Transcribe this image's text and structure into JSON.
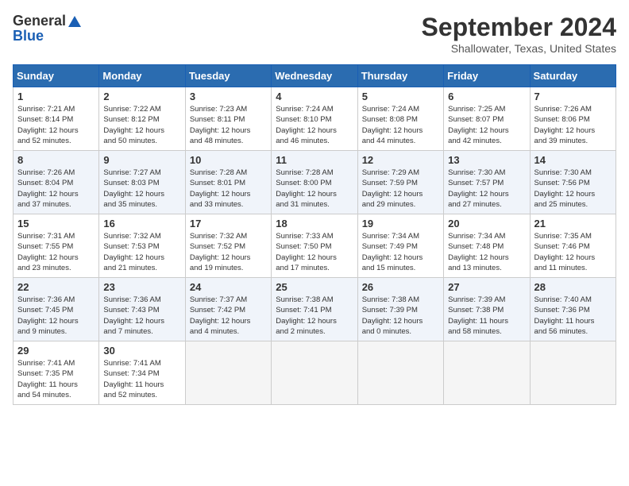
{
  "header": {
    "logo_line1": "General",
    "logo_line2": "Blue",
    "title": "September 2024",
    "location": "Shallowater, Texas, United States"
  },
  "days_of_week": [
    "Sunday",
    "Monday",
    "Tuesday",
    "Wednesday",
    "Thursday",
    "Friday",
    "Saturday"
  ],
  "weeks": [
    [
      {
        "day": "1",
        "lines": [
          "Sunrise: 7:21 AM",
          "Sunset: 8:14 PM",
          "Daylight: 12 hours",
          "and 52 minutes."
        ]
      },
      {
        "day": "2",
        "lines": [
          "Sunrise: 7:22 AM",
          "Sunset: 8:12 PM",
          "Daylight: 12 hours",
          "and 50 minutes."
        ]
      },
      {
        "day": "3",
        "lines": [
          "Sunrise: 7:23 AM",
          "Sunset: 8:11 PM",
          "Daylight: 12 hours",
          "and 48 minutes."
        ]
      },
      {
        "day": "4",
        "lines": [
          "Sunrise: 7:24 AM",
          "Sunset: 8:10 PM",
          "Daylight: 12 hours",
          "and 46 minutes."
        ]
      },
      {
        "day": "5",
        "lines": [
          "Sunrise: 7:24 AM",
          "Sunset: 8:08 PM",
          "Daylight: 12 hours",
          "and 44 minutes."
        ]
      },
      {
        "day": "6",
        "lines": [
          "Sunrise: 7:25 AM",
          "Sunset: 8:07 PM",
          "Daylight: 12 hours",
          "and 42 minutes."
        ]
      },
      {
        "day": "7",
        "lines": [
          "Sunrise: 7:26 AM",
          "Sunset: 8:06 PM",
          "Daylight: 12 hours",
          "and 39 minutes."
        ]
      }
    ],
    [
      {
        "day": "8",
        "lines": [
          "Sunrise: 7:26 AM",
          "Sunset: 8:04 PM",
          "Daylight: 12 hours",
          "and 37 minutes."
        ]
      },
      {
        "day": "9",
        "lines": [
          "Sunrise: 7:27 AM",
          "Sunset: 8:03 PM",
          "Daylight: 12 hours",
          "and 35 minutes."
        ]
      },
      {
        "day": "10",
        "lines": [
          "Sunrise: 7:28 AM",
          "Sunset: 8:01 PM",
          "Daylight: 12 hours",
          "and 33 minutes."
        ]
      },
      {
        "day": "11",
        "lines": [
          "Sunrise: 7:28 AM",
          "Sunset: 8:00 PM",
          "Daylight: 12 hours",
          "and 31 minutes."
        ]
      },
      {
        "day": "12",
        "lines": [
          "Sunrise: 7:29 AM",
          "Sunset: 7:59 PM",
          "Daylight: 12 hours",
          "and 29 minutes."
        ]
      },
      {
        "day": "13",
        "lines": [
          "Sunrise: 7:30 AM",
          "Sunset: 7:57 PM",
          "Daylight: 12 hours",
          "and 27 minutes."
        ]
      },
      {
        "day": "14",
        "lines": [
          "Sunrise: 7:30 AM",
          "Sunset: 7:56 PM",
          "Daylight: 12 hours",
          "and 25 minutes."
        ]
      }
    ],
    [
      {
        "day": "15",
        "lines": [
          "Sunrise: 7:31 AM",
          "Sunset: 7:55 PM",
          "Daylight: 12 hours",
          "and 23 minutes."
        ]
      },
      {
        "day": "16",
        "lines": [
          "Sunrise: 7:32 AM",
          "Sunset: 7:53 PM",
          "Daylight: 12 hours",
          "and 21 minutes."
        ]
      },
      {
        "day": "17",
        "lines": [
          "Sunrise: 7:32 AM",
          "Sunset: 7:52 PM",
          "Daylight: 12 hours",
          "and 19 minutes."
        ]
      },
      {
        "day": "18",
        "lines": [
          "Sunrise: 7:33 AM",
          "Sunset: 7:50 PM",
          "Daylight: 12 hours",
          "and 17 minutes."
        ]
      },
      {
        "day": "19",
        "lines": [
          "Sunrise: 7:34 AM",
          "Sunset: 7:49 PM",
          "Daylight: 12 hours",
          "and 15 minutes."
        ]
      },
      {
        "day": "20",
        "lines": [
          "Sunrise: 7:34 AM",
          "Sunset: 7:48 PM",
          "Daylight: 12 hours",
          "and 13 minutes."
        ]
      },
      {
        "day": "21",
        "lines": [
          "Sunrise: 7:35 AM",
          "Sunset: 7:46 PM",
          "Daylight: 12 hours",
          "and 11 minutes."
        ]
      }
    ],
    [
      {
        "day": "22",
        "lines": [
          "Sunrise: 7:36 AM",
          "Sunset: 7:45 PM",
          "Daylight: 12 hours",
          "and 9 minutes."
        ]
      },
      {
        "day": "23",
        "lines": [
          "Sunrise: 7:36 AM",
          "Sunset: 7:43 PM",
          "Daylight: 12 hours",
          "and 7 minutes."
        ]
      },
      {
        "day": "24",
        "lines": [
          "Sunrise: 7:37 AM",
          "Sunset: 7:42 PM",
          "Daylight: 12 hours",
          "and 4 minutes."
        ]
      },
      {
        "day": "25",
        "lines": [
          "Sunrise: 7:38 AM",
          "Sunset: 7:41 PM",
          "Daylight: 12 hours",
          "and 2 minutes."
        ]
      },
      {
        "day": "26",
        "lines": [
          "Sunrise: 7:38 AM",
          "Sunset: 7:39 PM",
          "Daylight: 12 hours",
          "and 0 minutes."
        ]
      },
      {
        "day": "27",
        "lines": [
          "Sunrise: 7:39 AM",
          "Sunset: 7:38 PM",
          "Daylight: 11 hours",
          "and 58 minutes."
        ]
      },
      {
        "day": "28",
        "lines": [
          "Sunrise: 7:40 AM",
          "Sunset: 7:36 PM",
          "Daylight: 11 hours",
          "and 56 minutes."
        ]
      }
    ],
    [
      {
        "day": "29",
        "lines": [
          "Sunrise: 7:41 AM",
          "Sunset: 7:35 PM",
          "Daylight: 11 hours",
          "and 54 minutes."
        ]
      },
      {
        "day": "30",
        "lines": [
          "Sunrise: 7:41 AM",
          "Sunset: 7:34 PM",
          "Daylight: 11 hours",
          "and 52 minutes."
        ]
      },
      {
        "day": "",
        "lines": []
      },
      {
        "day": "",
        "lines": []
      },
      {
        "day": "",
        "lines": []
      },
      {
        "day": "",
        "lines": []
      },
      {
        "day": "",
        "lines": []
      }
    ]
  ]
}
